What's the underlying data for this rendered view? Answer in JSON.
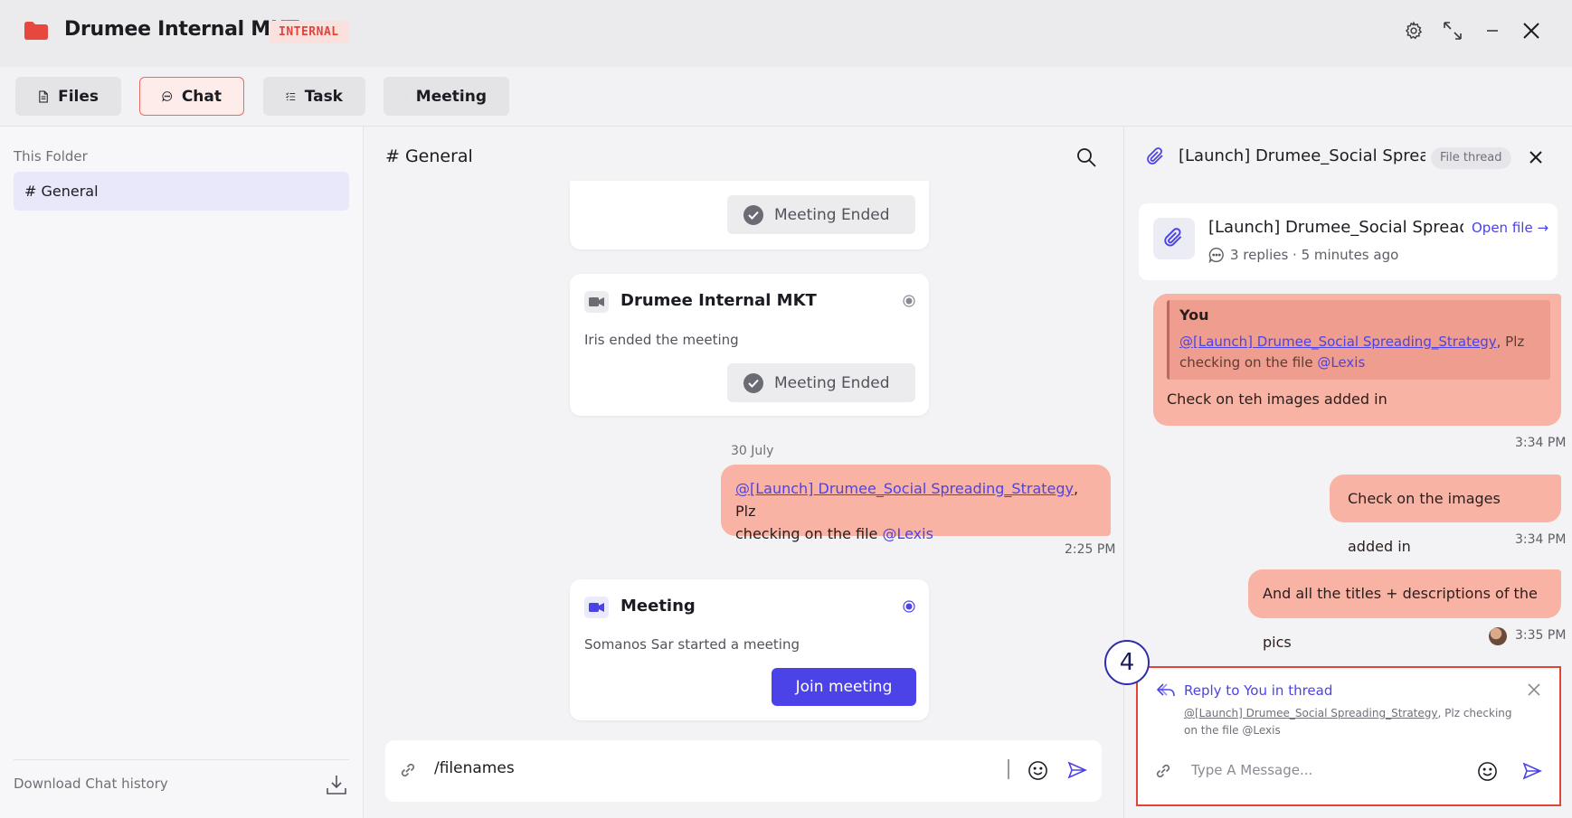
{
  "window": {
    "title": "Drumee Internal MKT",
    "badge": "INTERNAL",
    "accent_color": "#e0453a",
    "brand_color": "#4b43e8"
  },
  "tabs": [
    {
      "label": "Files",
      "icon": "file-icon",
      "active": false
    },
    {
      "label": "Chat",
      "icon": "chat-icon",
      "active": true
    },
    {
      "label": "Task",
      "icon": "task-list-icon",
      "active": false
    },
    {
      "label": "Meeting",
      "icon": "video-icon",
      "active": false
    }
  ],
  "sidebar": {
    "section_label": "This Folder",
    "channels": [
      "# General"
    ],
    "download_label": "Download Chat history"
  },
  "chat": {
    "channel_title": "# General",
    "meeting_ended_label": "Meeting Ended",
    "card1": {
      "title": "Drumee Internal MKT",
      "text": "Iris ended the meeting",
      "status": "Meeting Ended"
    },
    "date_separator": "30 July",
    "message": {
      "mention_link": "@[Launch] Drumee_Social Spreading_Strategy",
      "text1": ", Plz",
      "text2": "checking on the file ",
      "mention": "@Lexis",
      "time": "2:25 PM"
    },
    "card2": {
      "title": "Meeting",
      "text": "Somanos Sar started a meeting",
      "button": "Join meeting"
    },
    "composer_value": "/filenames"
  },
  "thread": {
    "title": "[Launch] Drumee_Social Spreading_Strategy",
    "badge": "File thread",
    "file_name": "[Launch] Drumee_Social Spreading_Strategy",
    "open_file": "Open file →",
    "replies": "3 replies · 5 minutes ago",
    "messages": [
      {
        "quote_author": "You",
        "quote_link": "@[Launch] Drumee_Social Spreading_Strategy",
        "quote_text1": ", Plz",
        "quote_text2": "checking on the file ",
        "quote_mention": "@Lexis",
        "text": "Check on teh images added in",
        "time": "3:34 PM"
      },
      {
        "text": "Check on the images added in",
        "time": "3:34 PM"
      },
      {
        "text": "And all the titles + descriptions of the pics",
        "time": "3:35 PM"
      }
    ],
    "reply": {
      "label": "Reply to You in thread",
      "quote_link": "@[Launch] Drumee_Social Spreading_Strategy",
      "quote_rest": ", Plz checking",
      "quote_line2": "on the file @Lexis",
      "placeholder": "Type A Message..."
    },
    "step_number": "4"
  }
}
